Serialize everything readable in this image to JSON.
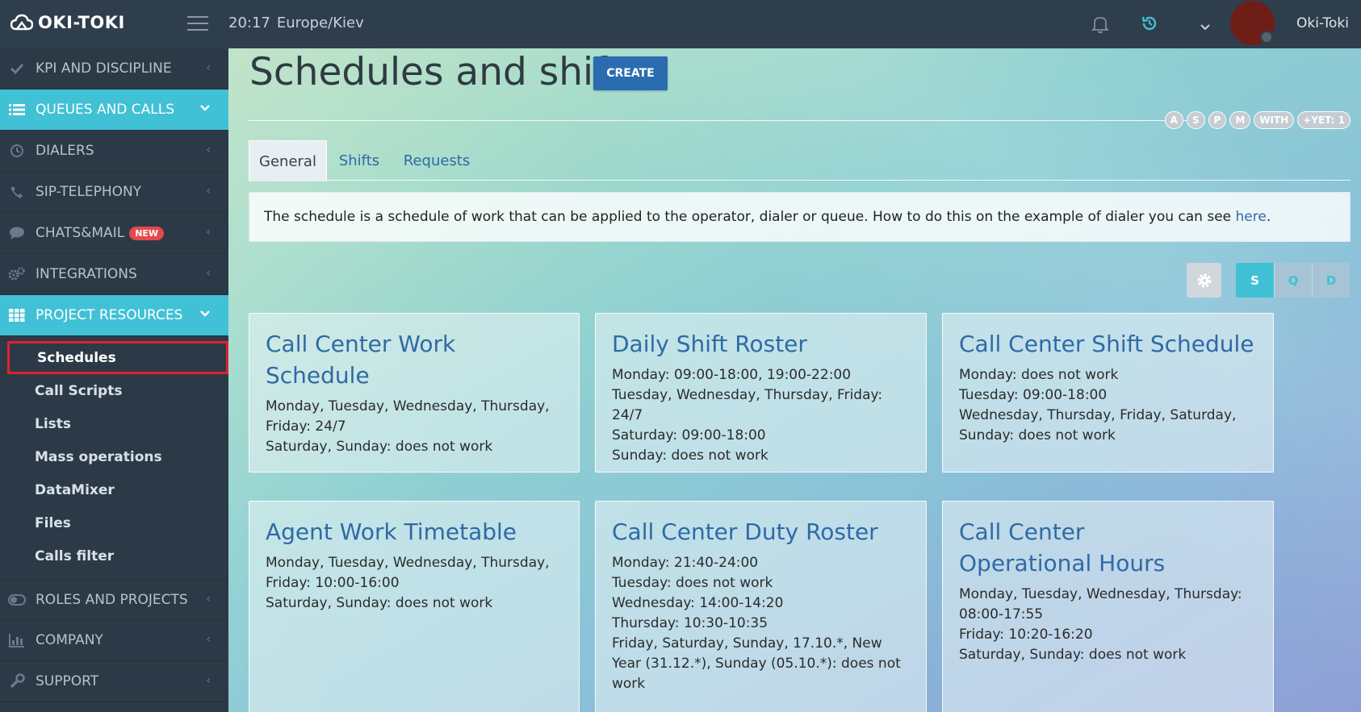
{
  "header": {
    "logo_text": "OKI-TOKI",
    "time": "20:17",
    "timezone": "Europe/Kiev",
    "username": "Oki-Toki"
  },
  "sidebar": {
    "items": [
      {
        "label": "KPI AND DISCIPLINE",
        "icon": "check-icon"
      },
      {
        "label": "QUEUES AND CALLS",
        "icon": "list-icon"
      },
      {
        "label": "DIALERS",
        "icon": "clock-icon"
      },
      {
        "label": "SIP-TELEPHONY",
        "icon": "phone-icon"
      },
      {
        "label": "CHATS&MAIL",
        "icon": "chat-icon",
        "badge": "NEW"
      },
      {
        "label": "INTEGRATIONS",
        "icon": "gears-icon"
      },
      {
        "label": "PROJECT RESOURCES",
        "icon": "grid-icon"
      },
      {
        "label": "ROLES AND PROJECTS",
        "icon": "toggle-icon"
      },
      {
        "label": "COMPANY",
        "icon": "bar-chart-icon"
      },
      {
        "label": "SUPPORT",
        "icon": "wrench-icon"
      }
    ],
    "sub_items": [
      "Schedules",
      "Call Scripts",
      "Lists",
      "Mass operations",
      "DataMixer",
      "Files",
      "Calls filter"
    ]
  },
  "main": {
    "title": "Schedules and shifts",
    "create_label": "CREATE",
    "filters": [
      "A",
      "S",
      "P",
      "M",
      "WITH",
      "+YET: 1"
    ],
    "tabs": [
      "General",
      "Shifts",
      "Requests"
    ],
    "info_text": "The schedule is a schedule of work that can be applied to the operator, dialer or queue. How to do this on the example of dialer you can see ",
    "info_link": "here",
    "info_end": ".",
    "view_toggle": [
      "S",
      "Q",
      "D"
    ],
    "cards": [
      {
        "title": "Call Center Work Schedule",
        "lines": [
          "Monday, Tuesday, Wednesday, Thursday,",
          "Friday: 24/7",
          "Saturday, Sunday: does not work"
        ]
      },
      {
        "title": "Daily Shift Roster",
        "lines": [
          "Monday: 09:00-18:00, 19:00-22:00",
          "Tuesday, Wednesday, Thursday, Friday:",
          "24/7",
          "Saturday: 09:00-18:00",
          "Sunday: does not work"
        ]
      },
      {
        "title": "Call Center Shift Schedule",
        "lines": [
          "Monday: does not work",
          "Tuesday: 09:00-18:00",
          "Wednesday, Thursday, Friday, Saturday,",
          "Sunday: does not work"
        ]
      },
      {
        "title": "Agent Work Timetable",
        "lines": [
          "Monday, Tuesday, Wednesday, Thursday,",
          "Friday: 10:00-16:00",
          "Saturday, Sunday: does not work"
        ]
      },
      {
        "title": "Call Center Duty Roster",
        "lines": [
          "Monday: 21:40-24:00",
          "Tuesday: does not work",
          "Wednesday: 14:00-14:20",
          "Thursday: 10:30-10:35",
          "Friday, Saturday, Sunday, 17.10.*, New",
          "Year (31.12.*), Sunday (05.10.*): does not",
          "work"
        ]
      },
      {
        "title": "Call Center Operational Hours",
        "lines": [
          "Monday, Tuesday, Wednesday, Thursday:",
          "08:00-17:55",
          "Friday: 10:20-16:20",
          "Saturday, Sunday: does not work"
        ]
      }
    ]
  },
  "colors": {
    "accent": "#41c1d5",
    "sidebar_bg": "#2c3a47",
    "header_bg": "#2f3e4c",
    "primary_button": "#2b6cb0",
    "selected_outline": "#e0212d",
    "badge": "#e5484d"
  }
}
